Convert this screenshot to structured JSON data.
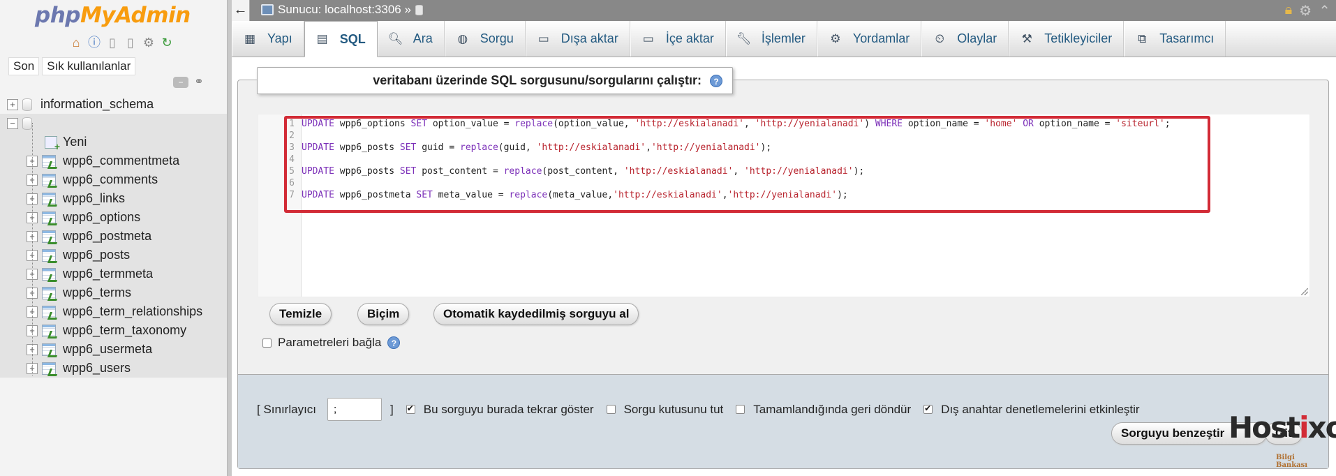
{
  "nav": {
    "logo_part1": "php",
    "logo_part2": "MyAdmin",
    "recent_tab": "Son",
    "favorites_tab": "Sık kullanılanlar",
    "databases": [
      {
        "name": "information_schema"
      },
      {
        "name": ""
      }
    ],
    "new_label": "Yeni",
    "tables": [
      "wpp6_commentmeta",
      "wpp6_comments",
      "wpp6_links",
      "wpp6_options",
      "wpp6_postmeta",
      "wpp6_posts",
      "wpp6_termmeta",
      "wpp6_terms",
      "wpp6_term_relationships",
      "wpp6_term_taxonomy",
      "wpp6_usermeta",
      "wpp6_users"
    ]
  },
  "topbar": {
    "back": "←",
    "server_label": "Sunucu: localhost:3306 »"
  },
  "tabs": [
    {
      "label": "Yapı",
      "icon": "structure-icon"
    },
    {
      "label": "SQL",
      "icon": "sql-icon",
      "active": true
    },
    {
      "label": "Ara",
      "icon": "search-icon"
    },
    {
      "label": "Sorgu",
      "icon": "query-icon"
    },
    {
      "label": "Dışa aktar",
      "icon": "export-icon"
    },
    {
      "label": "İçe aktar",
      "icon": "import-icon"
    },
    {
      "label": "İşlemler",
      "icon": "operations-icon"
    },
    {
      "label": "Yordamlar",
      "icon": "routines-icon"
    },
    {
      "label": "Olaylar",
      "icon": "events-icon"
    },
    {
      "label": "Tetikleyiciler",
      "icon": "triggers-icon"
    },
    {
      "label": "Tasarımcı",
      "icon": "designer-icon"
    }
  ],
  "main": {
    "legend_prefix": "veritabanı üzerinde ",
    "legend_sql": "SQL",
    "legend_suffix": " sorgusunu/sorgularını çalıştır:",
    "editor_lines": [
      "UPDATE wpp6_options SET option_value = replace(option_value, 'http://eskialanadi', 'http://yenialanadi') WHERE option_name = 'home' OR option_name = 'siteurl';",
      "",
      "UPDATE wpp6_posts SET guid = replace(guid, 'http://eskialanadi','http://yenialanadi');",
      "",
      "UPDATE wpp6_posts SET post_content = replace(post_content, 'http://eskialanadi', 'http://yenialanadi');",
      "",
      "UPDATE wpp6_postmeta SET meta_value = replace(meta_value,'http://eskialanadi','http://yenialanadi');"
    ],
    "buttons": {
      "clear": "Temizle",
      "format": "Biçim",
      "autosaved": "Otomatik kaydedilmiş sorguyu al"
    },
    "bind_params_label": "Parametreleri bağla"
  },
  "footer": {
    "delimiter_label_open": "[ Sınırlayıcı",
    "delimiter_value": ";",
    "delimiter_label_close": "]",
    "options": [
      {
        "label": "Bu sorguyu burada tekrar göster",
        "checked": true
      },
      {
        "label": "Sorgu kutusunu tut",
        "checked": false
      },
      {
        "label": "Tamamlandığında geri döndür",
        "checked": false
      },
      {
        "label": "Dış anahtar denetlemelerini etkinleştir",
        "checked": true
      }
    ],
    "simulate_button": "Sorguyu benzeştir",
    "go_button": "Git"
  },
  "watermark": {
    "brand_a": "Host",
    "brand_x": "i",
    "brand_b": "xo",
    "sub": "Bilgi Bankası"
  },
  "colors": {
    "link": "#235a81",
    "highlight": "#d22b36",
    "footer_bg": "#d5dde4"
  }
}
